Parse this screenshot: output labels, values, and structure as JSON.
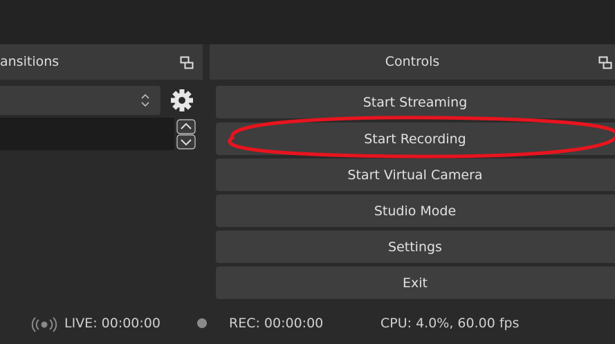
{
  "transitions": {
    "title": "ansitions",
    "select_value": ""
  },
  "controls": {
    "title": "Controls",
    "buttons": [
      {
        "label": "Start Streaming"
      },
      {
        "label": "Start Recording"
      },
      {
        "label": "Start Virtual Camera"
      },
      {
        "label": "Studio Mode"
      },
      {
        "label": "Settings"
      },
      {
        "label": "Exit"
      }
    ]
  },
  "status": {
    "live": "LIVE: 00:00:00",
    "rec": "REC: 00:00:00",
    "cpu": "CPU: 4.0%, 60.00 fps"
  },
  "colors": {
    "highlight": "#e8141e",
    "panel": "#3a3a3a",
    "button": "#3e3e3e",
    "background": "#2a2a2a"
  },
  "icons": {
    "dock_float": "dock-float-icon",
    "gear": "gear-icon",
    "live": "broadcast-icon",
    "rec": "record-dot-icon"
  }
}
